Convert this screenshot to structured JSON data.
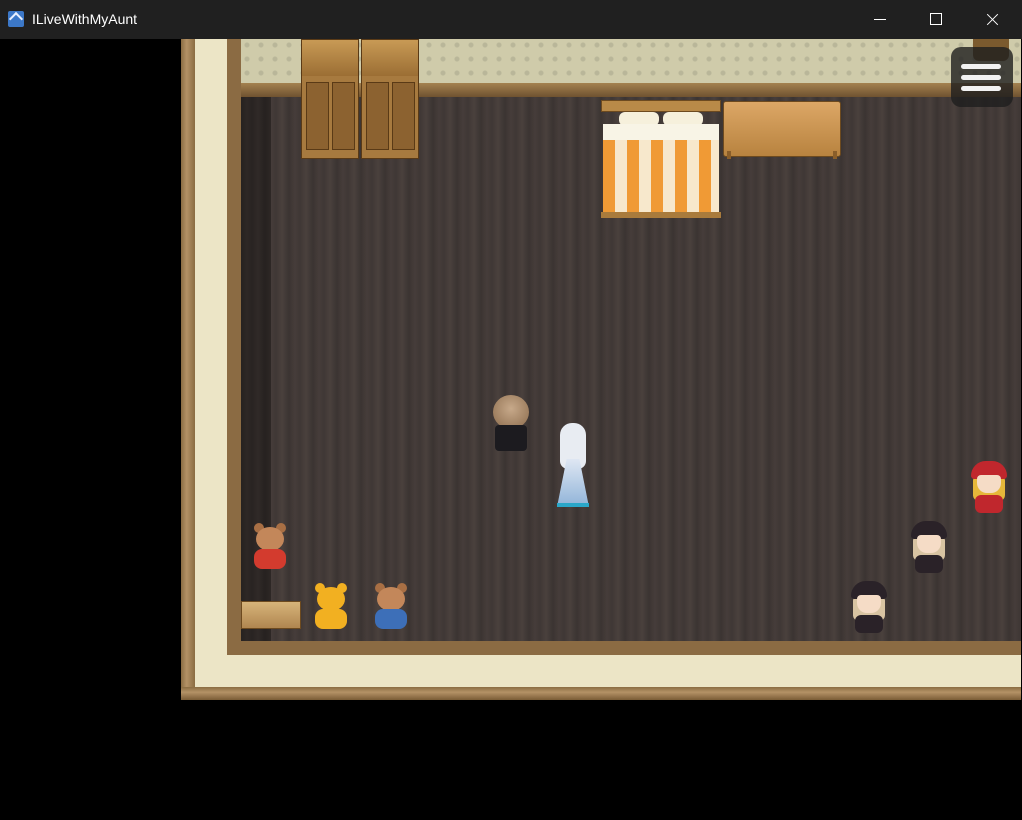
{
  "window": {
    "title": "ILiveWithMyAunt",
    "controls": {
      "minimize": "minimize",
      "maximize": "maximize",
      "close": "close"
    }
  },
  "game": {
    "menu_icon": "hamburger-menu-icon",
    "colors": {
      "floor": "#3f3735",
      "wall": "#ece5c6",
      "wallpaper": "#cfcbaa",
      "wood": "#a77a3f",
      "bed_stripe": "#f09a35",
      "teddy_red": "#d33b2e",
      "teddy_yellow": "#f2b021",
      "teddy_blue": "#3d6fb8",
      "doll_red": "#c0272d",
      "doll_black": "#2a2228"
    }
  }
}
